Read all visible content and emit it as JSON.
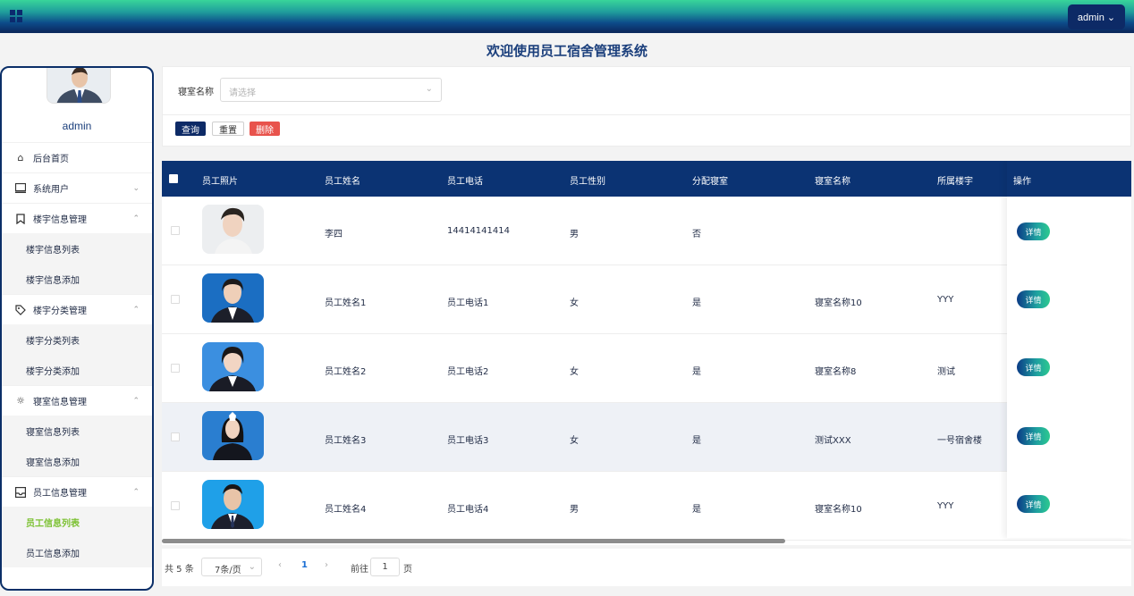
{
  "header": {
    "menu_icon": "grid-icon",
    "user_button": "admin ⌄"
  },
  "page_title": "欢迎使用员工宿舍管理系统",
  "sidebar": {
    "username": "admin",
    "menu": [
      {
        "type": "top",
        "icon": "home-icon",
        "label": "后台首页",
        "chevron": ""
      },
      {
        "type": "top",
        "icon": "monitor-icon",
        "label": "系统用户",
        "chevron": "⌄"
      },
      {
        "type": "top",
        "icon": "bookmark-icon",
        "label": "楼宇信息管理",
        "chevron": "⌃"
      },
      {
        "type": "sub",
        "label": "楼宇信息列表"
      },
      {
        "type": "sub",
        "label": "楼宇信息添加"
      },
      {
        "type": "top",
        "icon": "tag-icon",
        "label": "楼宇分类管理",
        "chevron": "⌃"
      },
      {
        "type": "sub",
        "label": "楼宇分类列表"
      },
      {
        "type": "sub",
        "label": "楼宇分类添加"
      },
      {
        "type": "top",
        "icon": "sun-icon",
        "label": "寝室信息管理",
        "chevron": "⌃"
      },
      {
        "type": "sub",
        "label": "寝室信息列表"
      },
      {
        "type": "sub",
        "label": "寝室信息添加"
      },
      {
        "type": "top",
        "icon": "inbox-icon",
        "label": "员工信息管理",
        "chevron": "⌃"
      },
      {
        "type": "sub",
        "label": "员工信息列表",
        "active": true
      },
      {
        "type": "sub",
        "label": "员工信息添加"
      }
    ]
  },
  "search": {
    "label": "寝室名称",
    "placeholder": "请选择",
    "query_btn": "查询",
    "reset_btn": "重置",
    "delete_btn": "删除"
  },
  "table": {
    "columns": [
      "员工照片",
      "员工姓名",
      "员工电话",
      "员工性别",
      "分配寝室",
      "寝室名称",
      "所属楼宇",
      "操作"
    ],
    "rows": [
      {
        "name": "李四",
        "phone": "14414141414",
        "gender": "男",
        "assigned": "否",
        "room": "",
        "building": "",
        "action": "详情"
      },
      {
        "name": "员工姓名1",
        "phone": "员工电话1",
        "gender": "女",
        "assigned": "是",
        "room": "寝室名称10",
        "building": "YYY",
        "action": "详情"
      },
      {
        "name": "员工姓名2",
        "phone": "员工电话2",
        "gender": "女",
        "assigned": "是",
        "room": "寝室名称8",
        "building": "测试",
        "action": "详情"
      },
      {
        "name": "员工姓名3",
        "phone": "员工电话3",
        "gender": "女",
        "assigned": "是",
        "room": "测试XXX",
        "building": "一号宿舍楼",
        "action": "详情"
      },
      {
        "name": "员工姓名4",
        "phone": "员工电话4",
        "gender": "男",
        "assigned": "是",
        "room": "寝室名称10",
        "building": "YYY",
        "action": "详情"
      }
    ]
  },
  "pagination": {
    "total": "共 5 条",
    "page_size": "7条/页",
    "current": "1",
    "goto_label": "前往",
    "goto_value": "1",
    "page_suffix": "页"
  }
}
